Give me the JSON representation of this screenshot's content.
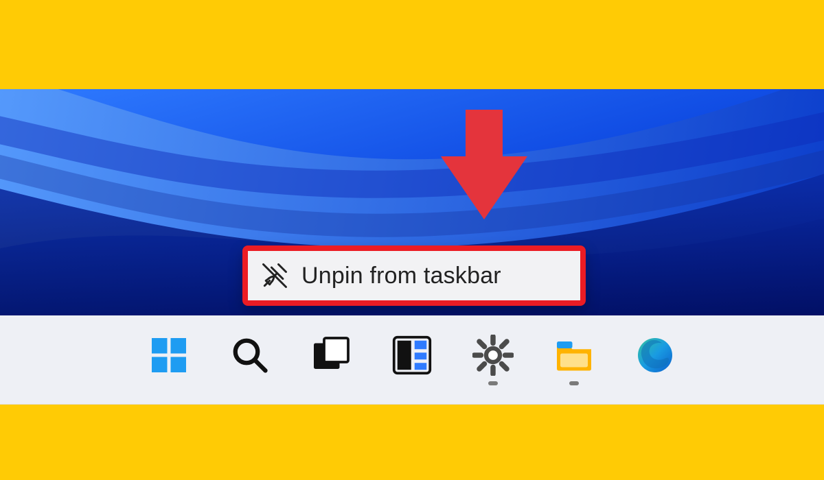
{
  "annotation": {
    "highlight_color": "#EC1C24",
    "background_band_color": "#FFCB05",
    "pointer_icon": "down-arrow"
  },
  "context_menu": {
    "icon": "unpin-icon",
    "label": "Unpin from taskbar"
  },
  "taskbar": {
    "background": "#eef0f5",
    "items": [
      {
        "name": "start",
        "icon": "start-icon",
        "active": false
      },
      {
        "name": "search",
        "icon": "search-icon",
        "active": false
      },
      {
        "name": "task-view",
        "icon": "task-view-icon",
        "active": false
      },
      {
        "name": "widgets",
        "icon": "widgets-icon",
        "active": false
      },
      {
        "name": "settings",
        "icon": "settings-icon",
        "active": true
      },
      {
        "name": "file-explorer",
        "icon": "file-explorer-icon",
        "active": true
      },
      {
        "name": "edge",
        "icon": "edge-icon",
        "active": false
      }
    ]
  }
}
